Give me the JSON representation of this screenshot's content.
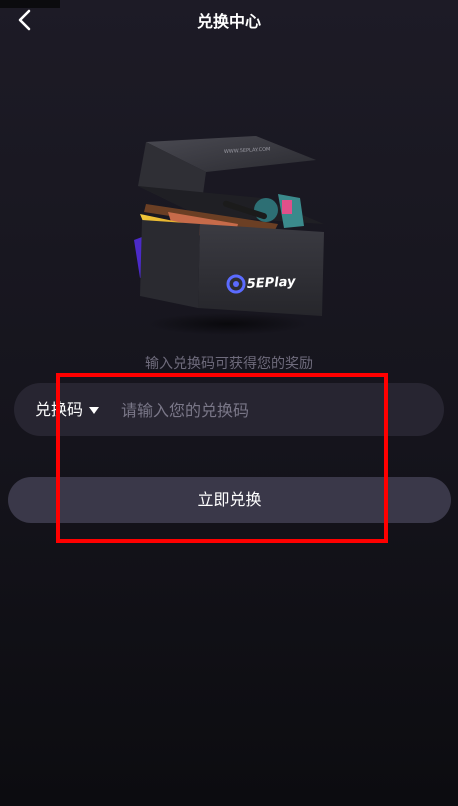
{
  "header": {
    "title": "兑换中心"
  },
  "hero": {
    "box_logo_text": "5EPlay",
    "box_sub_text": "WWW.5EPLAY.COM"
  },
  "hint_text": "输入兑换码可获得您的奖励",
  "form": {
    "type_label": "兑换码",
    "input_placeholder": "请输入您的兑换码",
    "input_value": ""
  },
  "submit_label": "立即兑换",
  "colors": {
    "background": "#17161e",
    "field": "#272531",
    "button": "#3a3849",
    "annotation": "#ff0000"
  }
}
